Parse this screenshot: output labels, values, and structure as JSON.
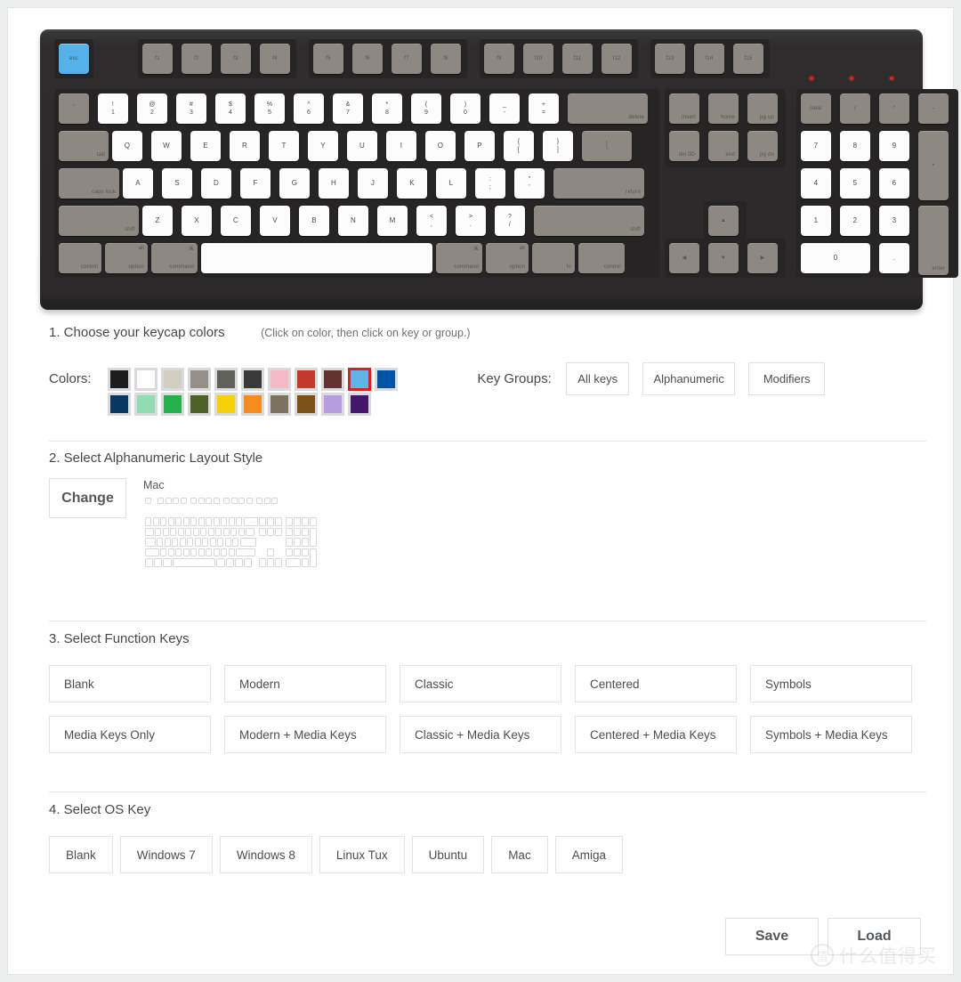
{
  "keyboard": {
    "esc": "esc",
    "fn_row": [
      "f1",
      "f2",
      "f3",
      "f4",
      "f5",
      "f6",
      "f7",
      "f8",
      "f9",
      "f10",
      "f11",
      "f12",
      "f13",
      "f14",
      "f15"
    ],
    "num_row": [
      {
        "top": "~",
        "bot": "`",
        "dark": true
      },
      {
        "top": "!",
        "bot": "1"
      },
      {
        "top": "@",
        "bot": "2"
      },
      {
        "top": "#",
        "bot": "3"
      },
      {
        "top": "$",
        "bot": "4"
      },
      {
        "top": "%",
        "bot": "5"
      },
      {
        "top": "^",
        "bot": "6"
      },
      {
        "top": "&",
        "bot": "7"
      },
      {
        "top": "*",
        "bot": "8"
      },
      {
        "top": "(",
        "bot": "9"
      },
      {
        "top": ")",
        "bot": "0"
      },
      {
        "top": "_",
        "bot": "-"
      },
      {
        "top": "+",
        "bot": "="
      }
    ],
    "delete": "delete",
    "tab": "tab",
    "row_q": [
      "Q",
      "W",
      "E",
      "R",
      "T",
      "Y",
      "U",
      "I",
      "O",
      "P"
    ],
    "brackets": [
      {
        "top": "{",
        "bot": "["
      },
      {
        "top": "}",
        "bot": "]"
      },
      {
        "top": "|",
        "bot": "\\"
      }
    ],
    "caps_lock": "caps lock",
    "row_a": [
      "A",
      "S",
      "D",
      "F",
      "G",
      "H",
      "J",
      "K",
      "L"
    ],
    "semicolon": {
      "top": ":",
      "bot": ";"
    },
    "quote": {
      "top": "\"",
      "bot": "'"
    },
    "return": "return",
    "shift_left": "shift",
    "row_z": [
      "Z",
      "X",
      "C",
      "V",
      "B",
      "N",
      "M"
    ],
    "comma": {
      "top": "<",
      "bot": ","
    },
    "period": {
      "top": ">",
      "bot": "."
    },
    "slash": {
      "top": "?",
      "bot": "/"
    },
    "shift_right": "shift",
    "control_left": "control",
    "option_left_top": "alt",
    "option_left": "option",
    "command_left_top": "⌘",
    "command_left": "command",
    "command_right_top": "⌘",
    "command_right": "command",
    "option_right_top": "alt",
    "option_right": "option",
    "fn": "fn",
    "control_right": "control",
    "nav": [
      "insert",
      "home",
      "pg up",
      "del ⌦",
      "end",
      "pg dn"
    ],
    "arrows": {
      "up": "▲",
      "left": "◀",
      "down": "▼",
      "right": "▶"
    },
    "numpad": {
      "clear": "clear",
      "divide": "/",
      "multiply": "*",
      "minus": "–",
      "n7": "7",
      "n8": "8",
      "n9": "9",
      "plus": "+",
      "n4": "4",
      "n5": "5",
      "n6": "6",
      "n1": "1",
      "n2": "2",
      "n3": "3",
      "enter": "enter",
      "n0": "0",
      "dot": "."
    }
  },
  "section1": {
    "title": "1. Choose your keycap colors",
    "note": "(Click on color, then click on key or group.)",
    "colors_label": "Colors:",
    "swatches_row1": [
      "#1d1d1d",
      "#ffffff",
      "#d3cec2",
      "#949089",
      "#61605b",
      "#3b3938",
      "#f4b8c6",
      "#c33a2c",
      "#653232",
      "#5fb4e8",
      "#0054a6"
    ],
    "swatches_row2": [
      "#0a3761",
      "#91dcb2",
      "#22b14c",
      "#4e6128",
      "#f5d108",
      "#f68b1f",
      "#7b7260",
      "#7c5019",
      "#b49ee0",
      "#44176b"
    ],
    "selected_swatch_index": 9,
    "key_groups_label": "Key Groups:",
    "key_groups": [
      "All keys",
      "Alphanumeric",
      "Modifiers"
    ]
  },
  "section2": {
    "title": "2. Select Alphanumeric Layout Style",
    "change_button": "Change",
    "preview_label": "Mac"
  },
  "section3": {
    "title": "3. Select Function Keys",
    "options": [
      "Blank",
      "Modern",
      "Classic",
      "Centered",
      "Symbols",
      "Media Keys Only",
      "Modern + Media Keys",
      "Classic + Media Keys",
      "Centered + Media Keys",
      "Symbols + Media Keys"
    ]
  },
  "section4": {
    "title": "4. Select OS Key",
    "options": [
      "Blank",
      "Windows 7",
      "Windows 8",
      "Linux Tux",
      "Ubuntu",
      "Mac",
      "Amiga"
    ]
  },
  "footer": {
    "save": "Save",
    "load": "Load"
  },
  "watermark": {
    "mark": "值",
    "text": "什么值得买"
  }
}
